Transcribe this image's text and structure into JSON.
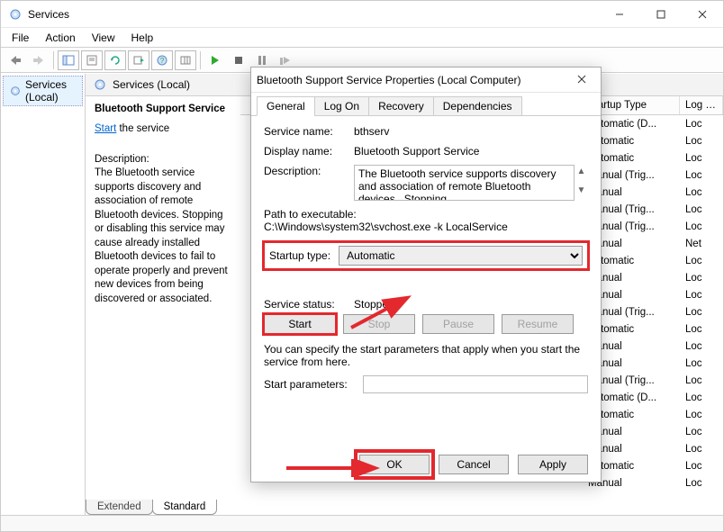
{
  "window": {
    "title": "Services",
    "min_tip": "Minimize",
    "max_tip": "Maximize",
    "close_tip": "Close"
  },
  "menu": {
    "file": "File",
    "action": "Action",
    "view": "View",
    "help": "Help"
  },
  "leftpane": {
    "root": "Services (Local)"
  },
  "detail": {
    "header": "Services (Local)",
    "service_name": "Bluetooth Support Service",
    "start_word": "Start",
    "start_rest": " the service",
    "desc_title": "Description:",
    "desc_body": "The Bluetooth service supports discovery and association of remote Bluetooth devices.  Stopping or disabling this service may cause already installed Bluetooth devices to fail to operate properly and prevent new devices from being discovered or associated."
  },
  "footer_tabs": {
    "extended": "Extended",
    "standard": "Standard"
  },
  "grid": {
    "headers": {
      "startup": "Startup Type",
      "logon": "Log …"
    },
    "rows": [
      {
        "t": "Automatic (D...",
        "l": "Loc"
      },
      {
        "t": "Automatic",
        "l": "Loc"
      },
      {
        "t": "Automatic",
        "l": "Loc"
      },
      {
        "t": "Manual (Trig...",
        "l": "Loc"
      },
      {
        "t": "Manual",
        "l": "Loc"
      },
      {
        "t": "Manual (Trig...",
        "l": "Loc"
      },
      {
        "t": "Manual (Trig...",
        "l": "Loc"
      },
      {
        "t": "Manual",
        "l": "Net"
      },
      {
        "t": "Automatic",
        "l": "Loc"
      },
      {
        "t": "Manual",
        "l": "Loc"
      },
      {
        "t": "Manual",
        "l": "Loc"
      },
      {
        "t": "Manual (Trig...",
        "l": "Loc"
      },
      {
        "t": "Automatic",
        "l": "Loc"
      },
      {
        "t": "Manual",
        "l": "Loc"
      },
      {
        "t": "Manual",
        "l": "Loc"
      },
      {
        "t": "Manual (Trig...",
        "l": "Loc"
      },
      {
        "t": "Automatic (D...",
        "l": "Loc"
      },
      {
        "t": "Automatic",
        "l": "Loc"
      },
      {
        "t": "Manual",
        "l": "Loc"
      },
      {
        "t": "Manual",
        "l": "Loc"
      },
      {
        "t": "Automatic",
        "l": "Loc"
      },
      {
        "t": "Manual",
        "l": "Loc"
      }
    ]
  },
  "dialog": {
    "title": "Bluetooth Support Service Properties (Local Computer)",
    "tabs": {
      "general": "General",
      "logon": "Log On",
      "recovery": "Recovery",
      "deps": "Dependencies"
    },
    "labels": {
      "service_name": "Service name:",
      "display_name": "Display name:",
      "description": "Description:",
      "path": "Path to executable:",
      "startup_type": "Startup type:",
      "service_status": "Service status:",
      "start_params": "Start parameters:"
    },
    "service_name_val": "bthserv",
    "display_name_val": "Bluetooth Support Service",
    "description_val": "The Bluetooth service supports discovery and association of remote Bluetooth devices.  Stopping",
    "path_val": "C:\\Windows\\system32\\svchost.exe -k LocalService",
    "startup_type_val": "Automatic",
    "service_status_val": "Stopped",
    "btn_start": "Start",
    "btn_stop": "Stop",
    "btn_pause": "Pause",
    "btn_resume": "Resume",
    "note": "You can specify the start parameters that apply when you start the service from here.",
    "ok": "OK",
    "cancel": "Cancel",
    "apply": "Apply"
  }
}
